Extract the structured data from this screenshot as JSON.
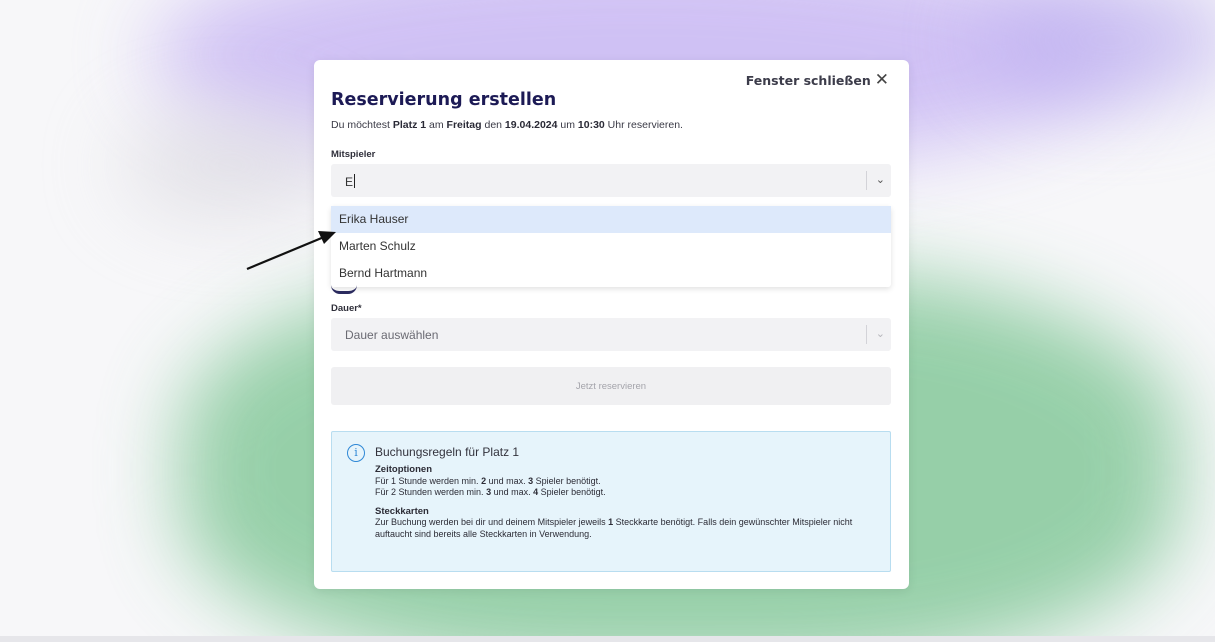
{
  "modal": {
    "close_label": "Fenster schließen",
    "close_icon": "close-icon",
    "title": "Reservierung erstellen",
    "subtitle": {
      "prefix": "Du möchtest ",
      "court": "Platz 1",
      "mid1": " am ",
      "day": "Freitag",
      "mid2": " den ",
      "date": "19.04.2024",
      "mid3": " um ",
      "time": "10:30",
      "suffix": " Uhr reservieren."
    },
    "players_label": "Mitspieler",
    "players_input_value": "E",
    "players_options": [
      "Erika Hauser",
      "Marten Schulz",
      "Bernd Hartmann"
    ],
    "duration_label": "Dauer*",
    "duration_placeholder": "Dauer auswählen",
    "reserve_button": "Jetzt reservieren",
    "info": {
      "icon": "info-icon",
      "title": "Buchungsregeln für Platz 1",
      "time_heading": "Zeitoptionen",
      "time_line1": {
        "a": "Für 1 Stunde werden min. ",
        "min": "2",
        "b": " und max. ",
        "max": "3",
        "c": " Spieler benötigt."
      },
      "time_line2": {
        "a": "Für 2 Stunden werden min. ",
        "min": "3",
        "b": " und max. ",
        "max": "4",
        "c": " Spieler benötigt."
      },
      "cards_heading": "Steckkarten",
      "cards_text": {
        "a": "Zur Buchung werden bei dir und deinem Mitspieler jeweils ",
        "count": "1",
        "b": " Steckkarte benötigt. Falls dein gewünschter Mitspieler nicht auftaucht sind bereits alle Steckkarten in Verwendung."
      }
    }
  },
  "colors": {
    "title": "#1c1a55",
    "highlight_option": "#dde9fb",
    "info_background": "#e6f4fb",
    "info_icon": "#2f88d6"
  }
}
